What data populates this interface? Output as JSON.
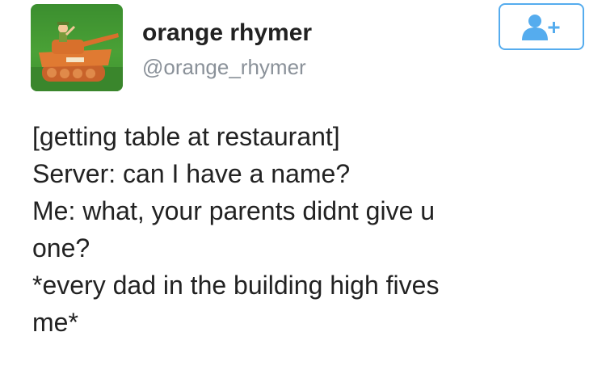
{
  "user": {
    "display_name": "orange rhymer",
    "handle": "@orange_rhymer",
    "avatar_icon": "tank-icon"
  },
  "follow_button": {
    "icon": "add-user-icon",
    "color": "#55acee"
  },
  "tweet": {
    "lines": [
      "[getting table at restaurant]",
      "Server: can I have a name?",
      "Me: what, your parents didnt give u",
      "one?",
      "*every dad in the building high fives",
      "me*"
    ]
  }
}
